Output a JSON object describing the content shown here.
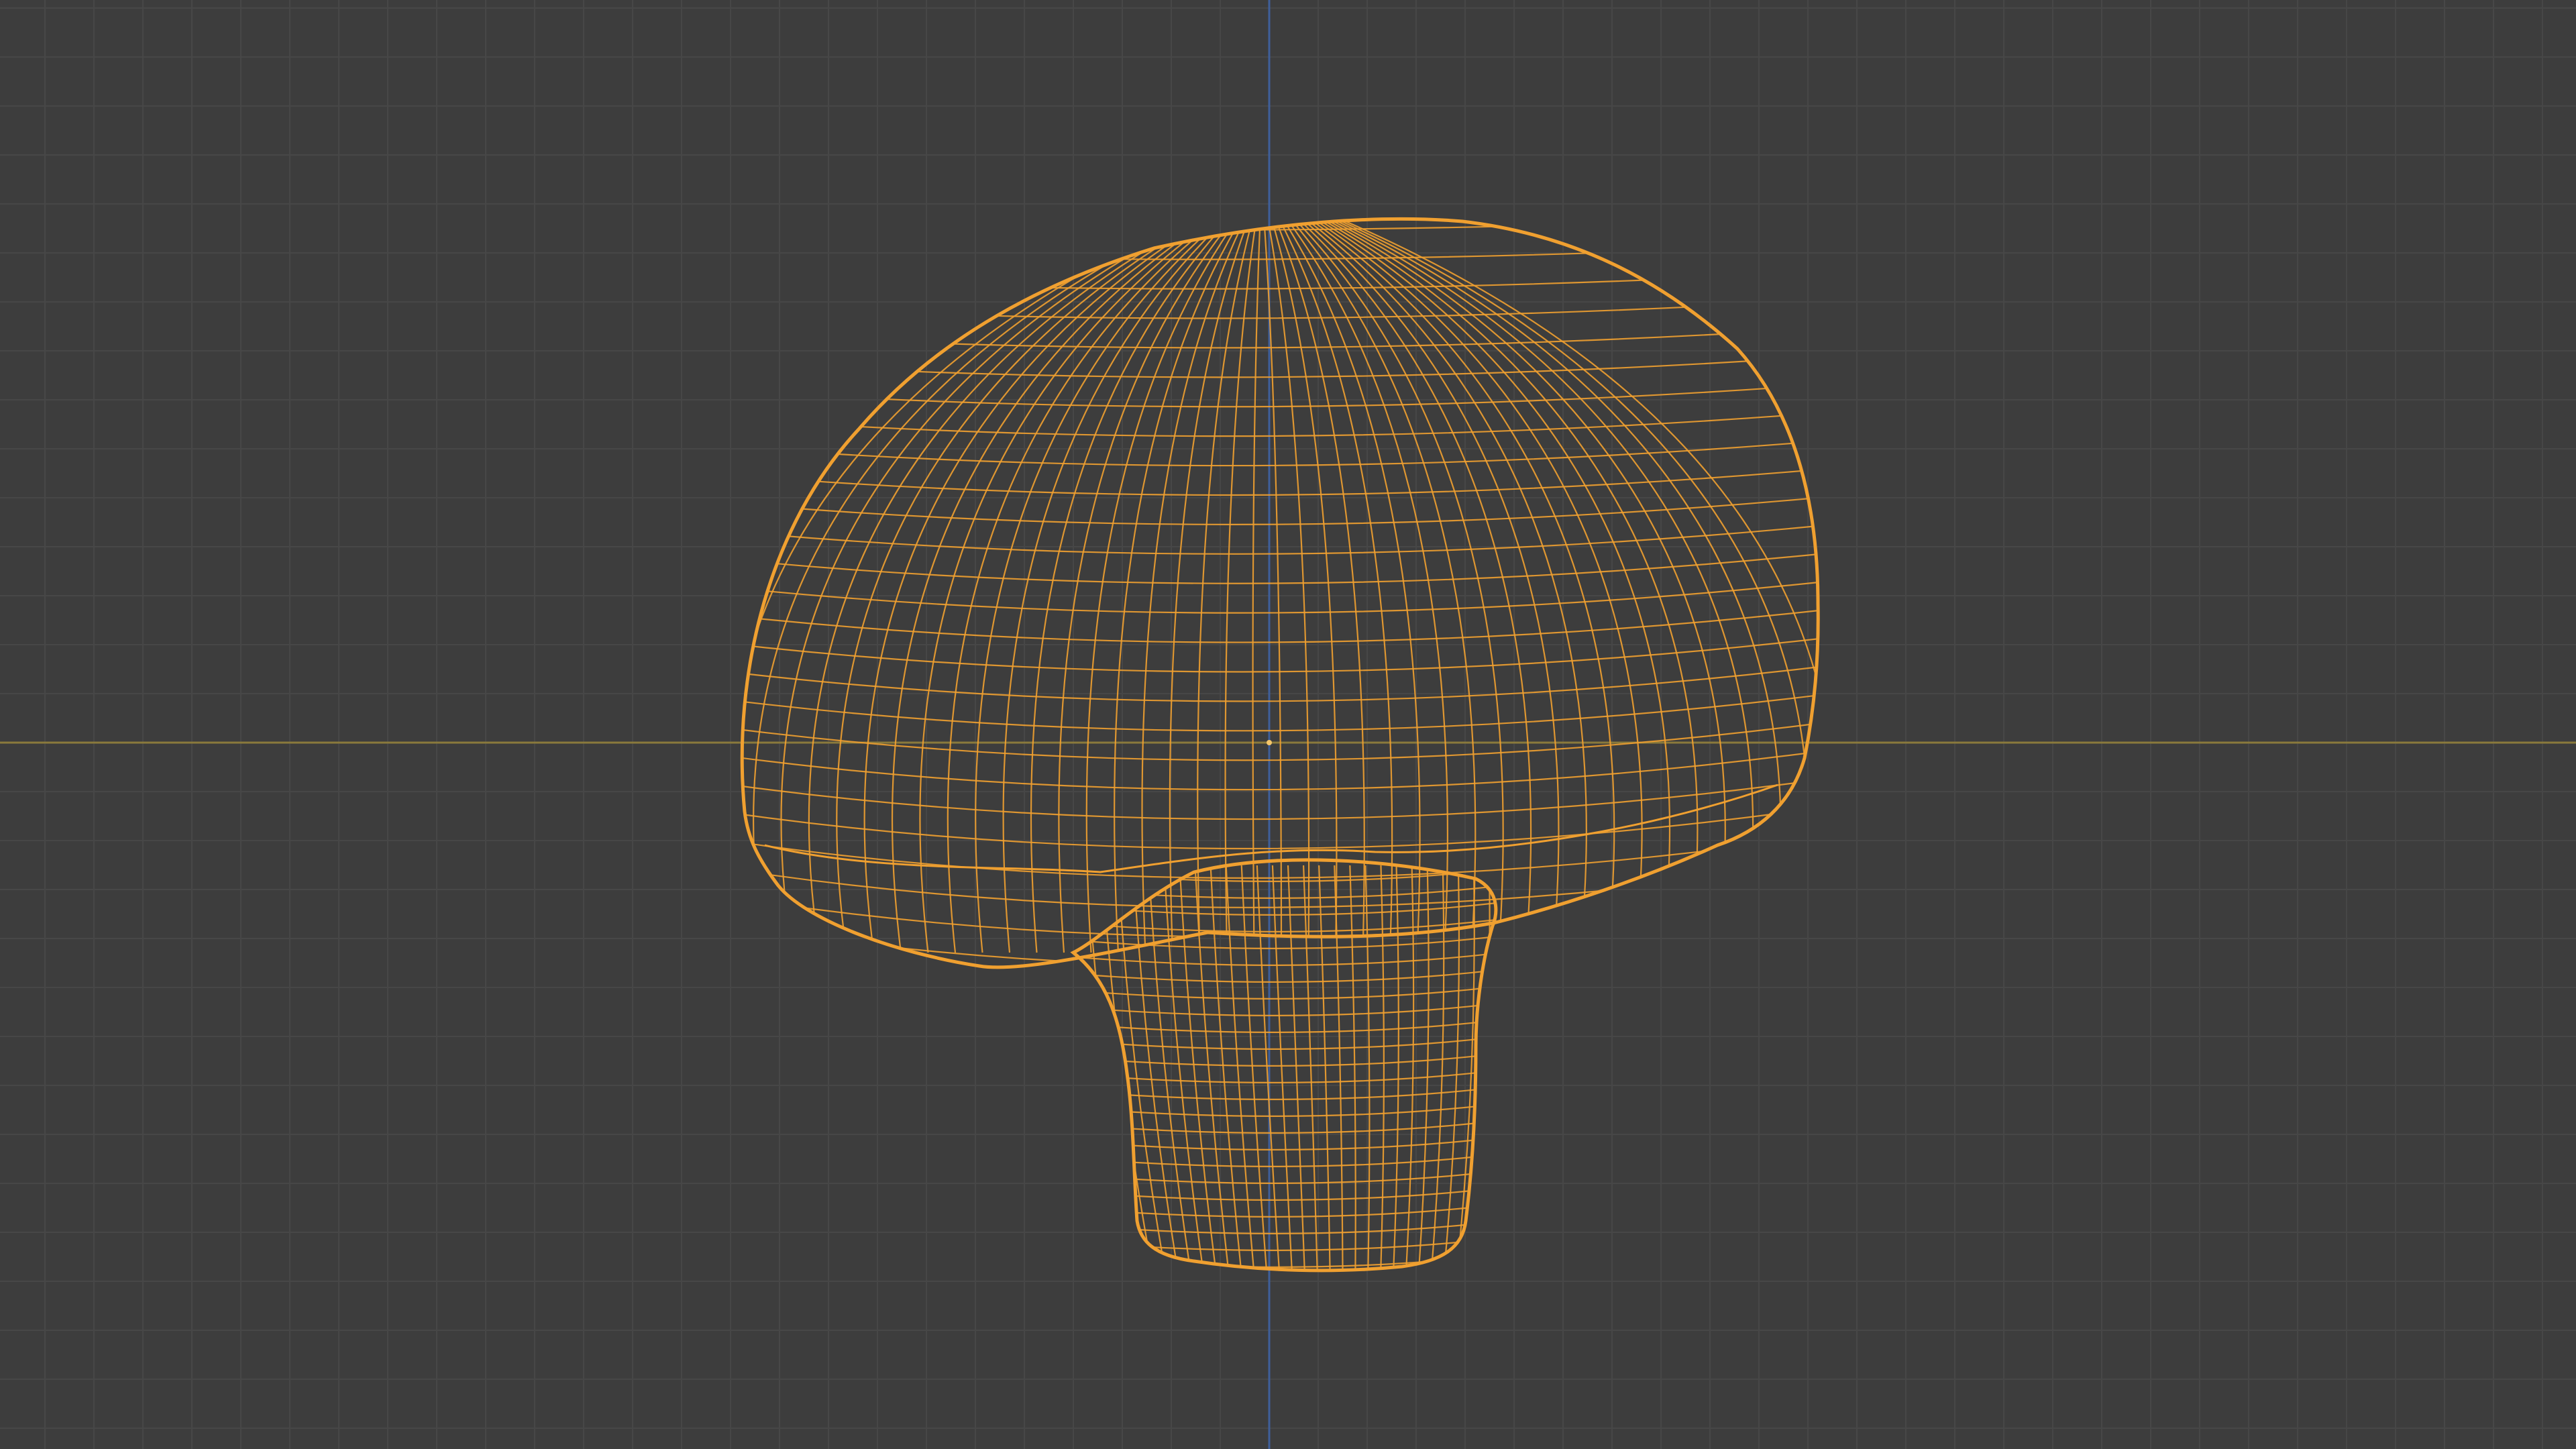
{
  "viewport": {
    "view": "wireframe",
    "background_color": "#3d3d3d",
    "grid_color": "#474747",
    "axis_x_color": "#8a7a3c",
    "axis_z_color": "#3f5f9a",
    "selection_color": "#f0a030",
    "origin_color": "#f5c66a"
  },
  "object": {
    "name_icon": "mushroom-mesh",
    "selected": true,
    "display": "wire"
  }
}
